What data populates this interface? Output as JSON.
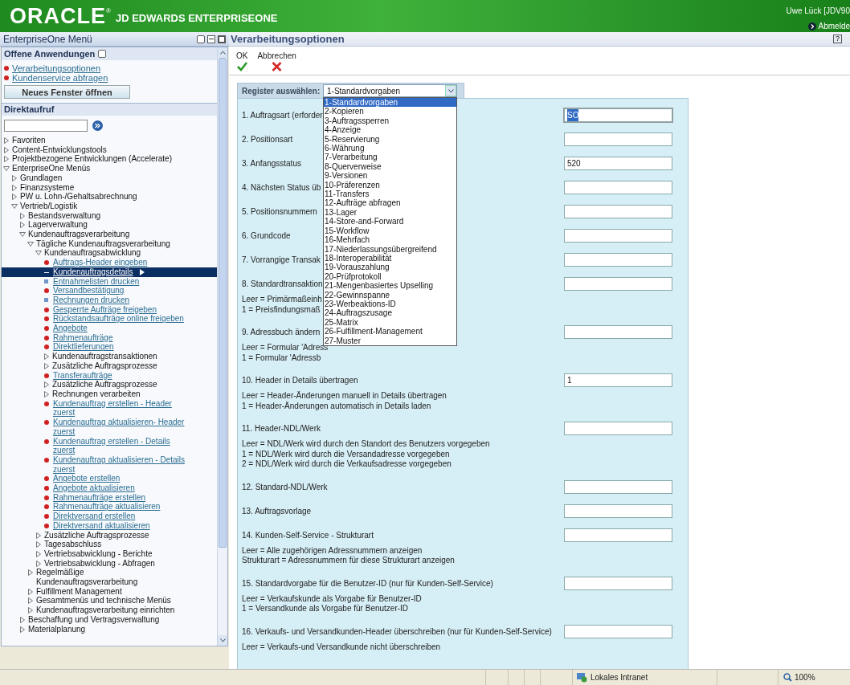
{
  "header": {
    "logo": "ORACLE",
    "logo_mark": "®",
    "product": "JD EDWARDS ENTERPRISEONE",
    "user": "Uwe Lück [JDV90",
    "logout": "Abmelde"
  },
  "menu_panel": {
    "title": "EnterpriseOne Menü",
    "open_apps": {
      "title": "Offene Anwendungen",
      "items": [
        "Verarbeitungsoptionen",
        "Kundenservice abfragen"
      ],
      "button": "Neues Fenster öffnen"
    },
    "fast_path": {
      "title": "Direktaufruf"
    },
    "tree": [
      {
        "label": "Favoriten",
        "kind": "folder",
        "expanded": false
      },
      {
        "label": "Content-Entwicklungstools",
        "kind": "folder",
        "expanded": false
      },
      {
        "label": "Projektbezogene Entwicklungen (Accelerate)",
        "kind": "folder",
        "expanded": false
      },
      {
        "label": "EnterpriseOne Menüs",
        "kind": "folder",
        "expanded": true,
        "children": [
          {
            "label": "Grundlagen",
            "kind": "folder",
            "expanded": false
          },
          {
            "label": "Finanzsysteme",
            "kind": "folder",
            "expanded": false
          },
          {
            "label": "PW u. Lohn-/Gehaltsabrechnung",
            "kind": "folder",
            "expanded": false
          },
          {
            "label": "Vertrieb/Logistik",
            "kind": "folder",
            "expanded": true,
            "children": [
              {
                "label": "Bestandsverwaltung",
                "kind": "folder",
                "expanded": false
              },
              {
                "label": "Lagerverwaltung",
                "kind": "folder",
                "expanded": false
              },
              {
                "label": "Kundenauftragsverarbeitung",
                "kind": "folder",
                "expanded": true,
                "children": [
                  {
                    "label": "Tägliche Kundenauftragsverarbeitung",
                    "kind": "folder",
                    "expanded": true,
                    "children": [
                      {
                        "label": "Kundenauftragsabwicklung",
                        "kind": "folder",
                        "expanded": true,
                        "children": [
                          {
                            "label": "Auftrags-Header eingeben",
                            "kind": "task",
                            "selected": false
                          },
                          {
                            "label": "Kundenauftragsdetails",
                            "kind": "task",
                            "selected": true
                          },
                          {
                            "label": "Entnahmelisten drucken",
                            "kind": "report",
                            "selected": false
                          },
                          {
                            "label": "Versandbestätigung",
                            "kind": "task",
                            "selected": false
                          },
                          {
                            "label": "Rechnungen drucken",
                            "kind": "report",
                            "selected": false
                          },
                          {
                            "label": "Gesperrte Aufträge freigeben",
                            "kind": "task",
                            "selected": false
                          },
                          {
                            "label": "Rückstandsaufträge online freigeben",
                            "kind": "task",
                            "selected": false
                          },
                          {
                            "label": "Angebote",
                            "kind": "task",
                            "selected": false
                          },
                          {
                            "label": "Rahmenaufträge",
                            "kind": "task",
                            "selected": false
                          },
                          {
                            "label": "Direktlieferungen",
                            "kind": "task",
                            "selected": false
                          },
                          {
                            "label": "Kundenauftragstransaktionen",
                            "kind": "folder",
                            "expanded": false
                          },
                          {
                            "label": "Zusätzliche Auftragsprozesse",
                            "kind": "folder",
                            "expanded": false
                          },
                          {
                            "label": "Transferaufträge",
                            "kind": "task",
                            "selected": false
                          },
                          {
                            "label": "Zusätzliche Auftragsprozesse",
                            "kind": "folder",
                            "expanded": false
                          },
                          {
                            "label": "Rechnungen verarbeiten",
                            "kind": "folder",
                            "expanded": false
                          },
                          {
                            "label": "Kundenauftrag erstellen - Header zuerst",
                            "kind": "task",
                            "selected": false
                          },
                          {
                            "label": "Kundenauftrag aktualisieren- Header zuerst",
                            "kind": "task",
                            "selected": false
                          },
                          {
                            "label": "Kundenauftrag erstellen - Details zuerst",
                            "kind": "task",
                            "selected": false
                          },
                          {
                            "label": "Kundenauftrag aktualisieren - Details zuerst",
                            "kind": "task",
                            "selected": false
                          },
                          {
                            "label": "Angebote erstellen",
                            "kind": "task",
                            "selected": false
                          },
                          {
                            "label": "Angebote aktualisieren",
                            "kind": "task",
                            "selected": false
                          },
                          {
                            "label": "Rahmenaufträge erstellen",
                            "kind": "task",
                            "selected": false
                          },
                          {
                            "label": "Rahmenaufträge aktualisieren",
                            "kind": "task",
                            "selected": false
                          },
                          {
                            "label": "Direktversand erstellen",
                            "kind": "task",
                            "selected": false
                          },
                          {
                            "label": "Direktversand aktualisieren",
                            "kind": "task",
                            "selected": false
                          }
                        ]
                      },
                      {
                        "label": "Zusätzliche Auftragsprozesse",
                        "kind": "folder",
                        "expanded": false
                      },
                      {
                        "label": "Tagesabschluss",
                        "kind": "folder",
                        "expanded": false
                      },
                      {
                        "label": "Vertriebsabwicklung - Berichte",
                        "kind": "folder",
                        "expanded": false
                      },
                      {
                        "label": "Vertriebsabwicklung - Abfragen",
                        "kind": "folder",
                        "expanded": false
                      }
                    ]
                  },
                  {
                    "label": "Regelmäßige Kundenauftragsverarbeitung",
                    "kind": "folder",
                    "expanded": false
                  },
                  {
                    "label": "Fulfillment Management",
                    "kind": "folder",
                    "expanded": false
                  },
                  {
                    "label": "Gesamtmenüs und technische Menüs",
                    "kind": "folder",
                    "expanded": false
                  },
                  {
                    "label": "Kundenauftragsverarbeitung einrichten",
                    "kind": "folder",
                    "expanded": false
                  }
                ]
              },
              {
                "label": "Beschaffung und Vertragsverwaltung",
                "kind": "folder",
                "expanded": false
              },
              {
                "label": "Materialplanung",
                "kind": "folder",
                "expanded": false
              }
            ]
          }
        ]
      }
    ]
  },
  "main": {
    "title": "Verarbeitungsoptionen",
    "help": "?",
    "toolbar": [
      {
        "label": "OK",
        "kind": "ok"
      },
      {
        "label": "Abbrechen",
        "kind": "cancel"
      }
    ],
    "register": {
      "label": "Register auswählen:",
      "value": "1-Standardvorgaben",
      "expanded": true,
      "options": [
        {
          "label": "1-Standardvorgaben",
          "selected": true
        },
        {
          "label": "2-Kopieren",
          "selected": false
        },
        {
          "label": "3-Auftragssperren",
          "selected": false
        },
        {
          "label": "4-Anzeige",
          "selected": false
        },
        {
          "label": "5-Reservierung",
          "selected": false
        },
        {
          "label": "6-Währung",
          "selected": false
        },
        {
          "label": "7-Verarbeitung",
          "selected": false
        },
        {
          "label": "8-Querverweise",
          "selected": false
        },
        {
          "label": "9-Versionen",
          "selected": false
        },
        {
          "label": "10-Präferenzen",
          "selected": false
        },
        {
          "label": "11-Transfers",
          "selected": false
        },
        {
          "label": "12-Aufträge abfragen",
          "selected": false
        },
        {
          "label": "13-Lager",
          "selected": false
        },
        {
          "label": "14-Store-and-Forward",
          "selected": false
        },
        {
          "label": "15-Workflow",
          "selected": false
        },
        {
          "label": "16-Mehrfach",
          "selected": false
        },
        {
          "label": "17-Niederlassungsübergreifend",
          "selected": false
        },
        {
          "label": "18-Interoperabilität",
          "selected": false
        },
        {
          "label": "19-Vorauszahlung",
          "selected": false
        },
        {
          "label": "20-Prüfprotokoll",
          "selected": false
        },
        {
          "label": "21-Mengenbasiertes Upselling",
          "selected": false
        },
        {
          "label": "22-Gewinnspanne",
          "selected": false
        },
        {
          "label": "23-Werbeaktions-ID",
          "selected": false
        },
        {
          "label": "24-Auftragszusage",
          "selected": false
        },
        {
          "label": "25-Matrix",
          "selected": false
        },
        {
          "label": "26-Fulfillment-Management",
          "selected": false
        },
        {
          "label": "27-Muster",
          "selected": false
        }
      ]
    },
    "options": [
      {
        "label": "1. Auftragsart (erforder",
        "value": "SO",
        "focused": true
      },
      {
        "label": "2. Positionsart",
        "focused": false
      },
      {
        "label": "3. Anfangsstatus",
        "value": "520",
        "focused": false
      },
      {
        "label": "4. Nächsten Status üb",
        "focused": false
      },
      {
        "label": "5. Positionsnummern",
        "focused": false
      },
      {
        "label": "6. Grundcode",
        "focused": false
      },
      {
        "label": "7. Vorrangige Transak",
        "focused": false
      },
      {
        "label": "8. Standardtransaktion",
        "focused": false,
        "description": [
          "Leer = Primärmaßeinh",
          "1 = Preisfindungsmaß"
        ]
      },
      {
        "label": "9. Adressbuch ändern",
        "focused": false,
        "description": [
          "Leer = Formular 'Adress",
          "1 = Formular 'Adressb"
        ]
      },
      {
        "label": "10. Header in Details übertragen",
        "value": "1",
        "focused": false,
        "description": [
          "Leer = Header-Änderungen manuell in Details übertragen",
          "1 = Header-Änderungen automatisch in Details laden"
        ]
      },
      {
        "label": "11. Header-NDL/Werk",
        "focused": false,
        "description": [
          "Leer = NDL/Werk wird durch den Standort des Benutzers vorgegeben",
          "1 = NDL/Werk wird durch die Versandadresse vorgegeben",
          "2 = NDL/Werk wird durch die Verkaufsadresse vorgegeben"
        ]
      },
      {
        "label": "12. Standard-NDL/Werk",
        "focused": false
      },
      {
        "label": "13. Auftragsvorlage",
        "focused": false
      },
      {
        "label": "14. Kunden-Self-Service - Strukturart",
        "focused": false,
        "description": [
          "Leer = Alle zugehörigen Adressnummern anzeigen",
          "Strukturart = Adressnummern für diese Strukturart anzeigen"
        ]
      },
      {
        "label": "15. Standardvorgabe für die Benutzer-ID (nur für Kunden-Self-Service)",
        "focused": false,
        "description": [
          "Leer = Verkaufskunde als Vorgabe für Benutzer-ID",
          "1 = Versandkunde als Vorgabe für Benutzer-ID"
        ]
      },
      {
        "label": "16. Verkaufs- und Versandkunden-Header überschreiben (nur für Kunden-Self-Service)",
        "focused": false,
        "description": [
          "Leer = Verkaufs-und Versandkunde nicht überschreiben"
        ]
      }
    ]
  },
  "status_bar": {
    "zone": "Lokales Intranet",
    "zoom": "100%"
  }
}
